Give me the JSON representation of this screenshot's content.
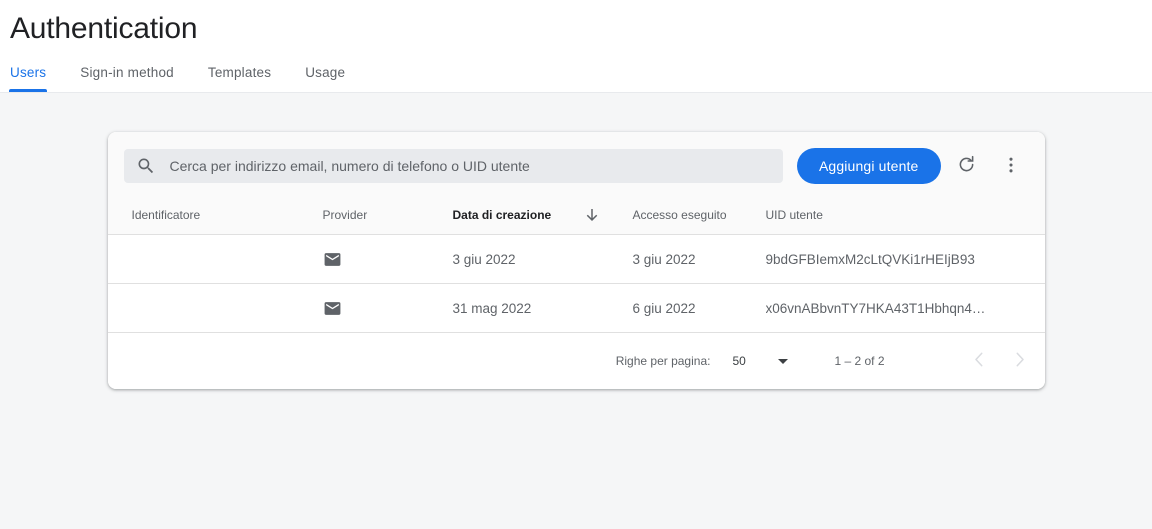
{
  "header": {
    "title": "Authentication",
    "tabs": [
      {
        "label": "Users",
        "active": true
      },
      {
        "label": "Sign-in method",
        "active": false
      },
      {
        "label": "Templates",
        "active": false
      },
      {
        "label": "Usage",
        "active": false
      }
    ]
  },
  "toolbar": {
    "search_placeholder": "Cerca per indirizzo email, numero di telefono o UID utente",
    "search_value": "",
    "add_user_label": "Aggiungi utente",
    "refresh_icon": "refresh-icon",
    "overflow_icon": "more-vert-icon",
    "search_icon": "search-icon"
  },
  "table": {
    "columns": [
      {
        "key": "identifier",
        "label": "Identificatore",
        "sorted": false
      },
      {
        "key": "provider",
        "label": "Provider",
        "sorted": false
      },
      {
        "key": "created",
        "label": "Data di creazione",
        "sorted": true
      },
      {
        "key": "signed_in",
        "label": "Accesso eseguito",
        "sorted": false
      },
      {
        "key": "uid",
        "label": "UID utente",
        "sorted": false
      }
    ],
    "sort_icon": "arrow-downward-icon",
    "rows": [
      {
        "identifier": "",
        "provider_icon": "email-icon",
        "created": "3 giu 2022",
        "signed_in": "3 giu 2022",
        "uid": "9bdGFBIemxM2cLtQVKi1rHEIjB93"
      },
      {
        "identifier": "",
        "provider_icon": "email-icon",
        "created": "31 mag 2022",
        "signed_in": "6 giu 2022",
        "uid": "x06vnABbvnTY7HKA43T1Hbhqn4…"
      }
    ]
  },
  "paginator": {
    "rows_per_page_label": "Righe per pagina:",
    "rows_per_page_value": "50",
    "range_label": "1 – 2 of 2",
    "prev_icon": "chevron-left-icon",
    "next_icon": "chevron-right-icon"
  },
  "colors": {
    "accent": "#1a73e8",
    "page_bg": "#f5f6f7",
    "card_bg": "#ffffff",
    "toolbar_bg": "#fafafa",
    "text_primary": "#202124",
    "text_secondary": "#5f6368"
  }
}
